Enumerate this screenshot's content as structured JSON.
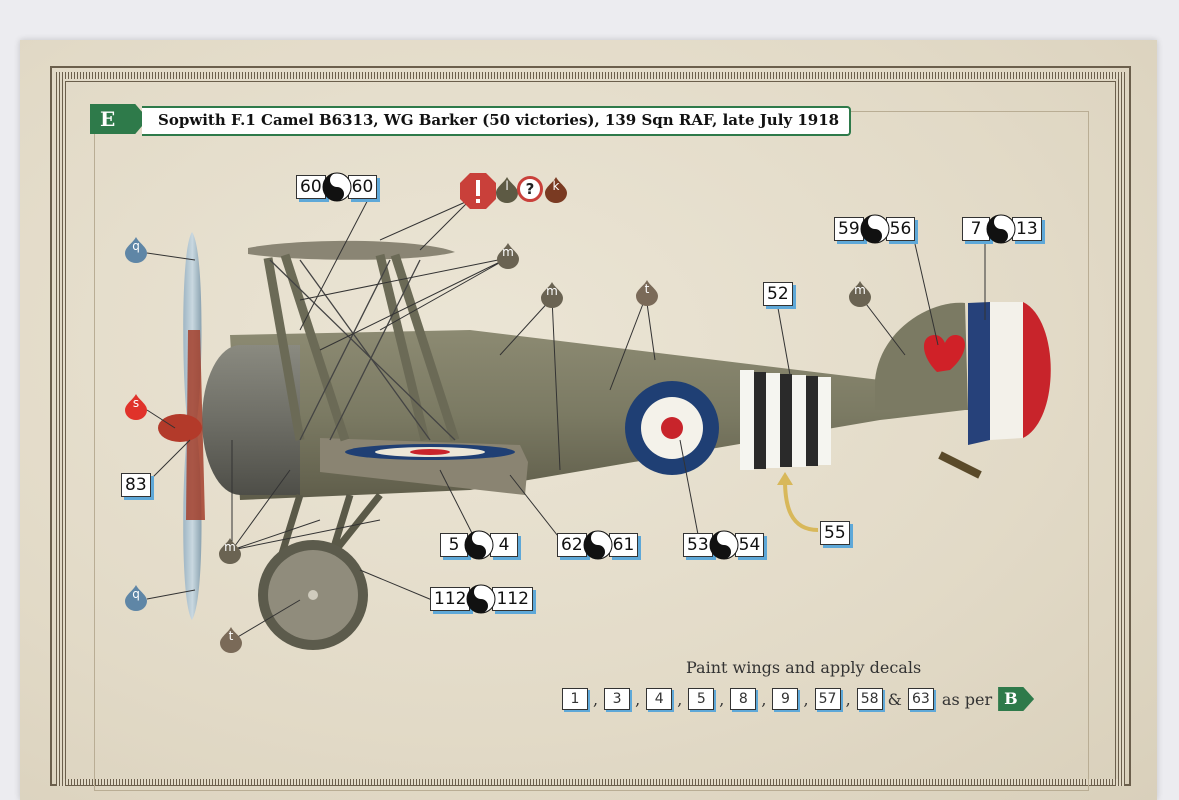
{
  "title": {
    "tag": "E",
    "text": "Sopwith F.1 Camel B6313, WG Barker (50 victories), 139 Sqn RAF, late July 1918"
  },
  "callouts": {
    "c60": {
      "left": "60",
      "right": "60"
    },
    "c59": {
      "left": "59",
      "right": "56"
    },
    "c7": {
      "left": "7",
      "right": "13"
    },
    "c52": "52",
    "c83": "83",
    "c5": {
      "left": "5",
      "right": "4"
    },
    "c62": {
      "left": "62",
      "right": "61"
    },
    "c53": {
      "left": "53",
      "right": "54"
    },
    "c55": "55",
    "c112": {
      "left": "112",
      "right": "112"
    }
  },
  "drops": {
    "q": "q",
    "s": "s",
    "m": "m",
    "t": "t",
    "l": "l",
    "k": "k",
    "question": "?",
    "warning": "!"
  },
  "colors": {
    "q": "#5f86a6",
    "s": "#e0322a",
    "m": "#6a6352",
    "t": "#7a6a58",
    "l": "#5d5a44",
    "k": "#7a3a22",
    "warning": "#c9403a",
    "accent": "#2e7a4a",
    "shadow": "#5ea8d8"
  },
  "paint_note": {
    "text": "Paint wings and apply decals",
    "decals": [
      "1",
      "3",
      "4",
      "5",
      "8",
      "9",
      "57",
      "58"
    ],
    "and": "&",
    "last": "63",
    "as_per": "as per",
    "ref": "B"
  }
}
